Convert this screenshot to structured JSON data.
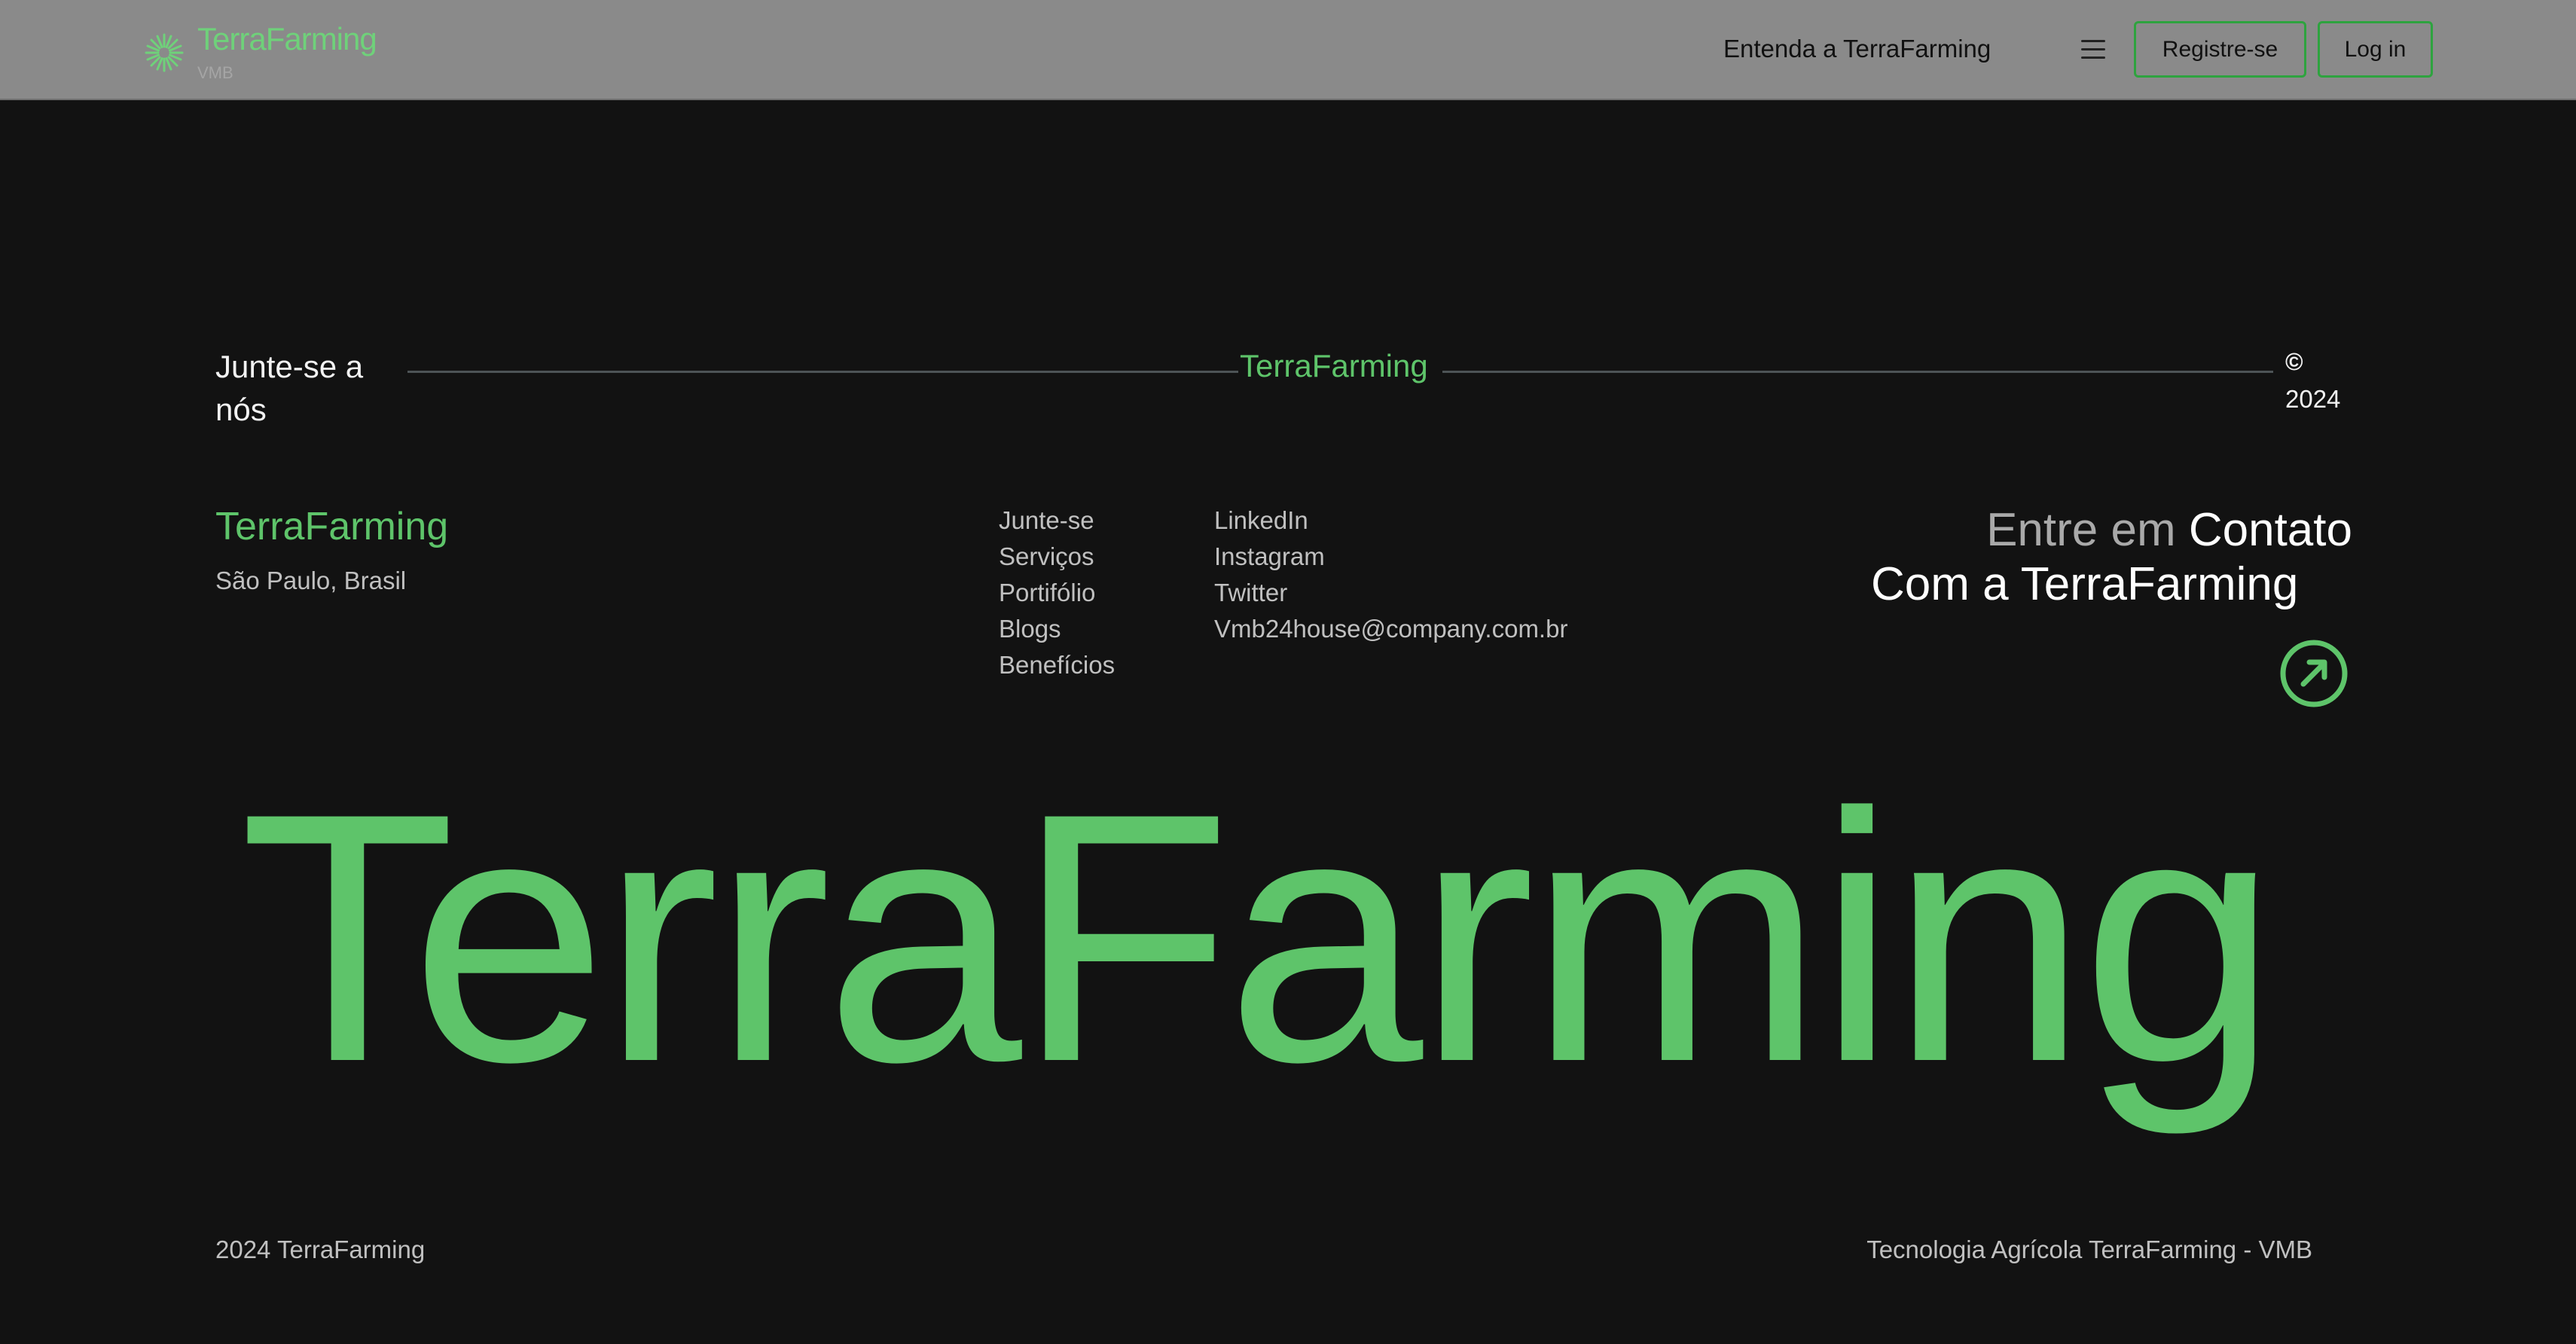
{
  "nav": {
    "brand": "TerraFarming",
    "brand_sub": "VMB",
    "link": "Entenda a TerraFarming",
    "menu_icon": "hamburger-icon",
    "register_label": "Registre-se",
    "login_label": "Log in"
  },
  "join": {
    "text": "Junte-se a nós",
    "brand": "TerraFarming",
    "copyright_symbol": "©",
    "year": "2024"
  },
  "info": {
    "brand": "TerraFarming",
    "location": "São Paulo, Brasil",
    "links": [
      "Junte-se",
      "Serviços",
      "Portifólio",
      "Blogs",
      "Benefícios"
    ],
    "social": [
      "LinkedIn",
      "Instagram",
      "Twitter",
      "Vmb24house@company.com.br"
    ],
    "contact_muted": "Entre em",
    "contact_strong": "Contato",
    "contact_line2": "Com a TerraFarming",
    "contact_icon": "arrow-up-right-circle-icon"
  },
  "hero": {
    "big_brand": "TerraFarming"
  },
  "footer": {
    "left": "2024 TerraFarming",
    "right": "Tecnologia Agrícola TerraFarming - VMB"
  },
  "colors": {
    "accent": "#5ec46a",
    "background": "#121212",
    "nav_bg": "#8a8a8a",
    "button_border": "#2ea33f"
  }
}
